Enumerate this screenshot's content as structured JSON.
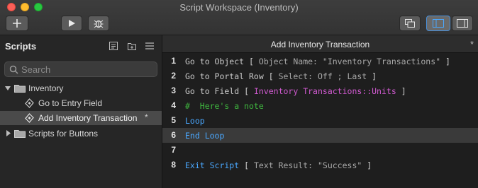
{
  "window": {
    "title": "Script Workspace (Inventory)"
  },
  "toolbar": {
    "new_script": "plus-icon",
    "run": "play-icon",
    "debug": "bug-icon"
  },
  "sidebar": {
    "title": "Scripts",
    "search_placeholder": "Search",
    "tree": [
      {
        "label": "Inventory",
        "type": "folder",
        "expanded": true
      },
      {
        "label": "Go to Entry Field",
        "type": "script"
      },
      {
        "label": "Add Inventory Transaction",
        "type": "script",
        "selected": true,
        "modified": "*"
      },
      {
        "label": "Scripts for Buttons",
        "type": "folder",
        "expanded": false
      }
    ]
  },
  "editor": {
    "tab_title": "Add Inventory Transaction",
    "modified_mark": "*",
    "lines": [
      {
        "n": "1",
        "step": "Go to Object",
        "open": "[",
        "params": " Object Name: \"Inventory Transactions\" ",
        "close": "]"
      },
      {
        "n": "2",
        "step": "Go to Portal Row",
        "open": "[",
        "params": " Select: Off ; Last ",
        "close": "]"
      },
      {
        "n": "3",
        "step": "Go to Field",
        "open": "[",
        "params": " Inventory Transactions::Units ",
        "close": "]"
      },
      {
        "n": "4",
        "comment": "#  Here's a note"
      },
      {
        "n": "5",
        "control": "Loop"
      },
      {
        "n": "6",
        "control": "End Loop"
      },
      {
        "n": "7"
      },
      {
        "n": "8",
        "step": "Exit Script",
        "open": "[",
        "params": " Text Result: \"Success\" ",
        "close": "]"
      }
    ]
  }
}
